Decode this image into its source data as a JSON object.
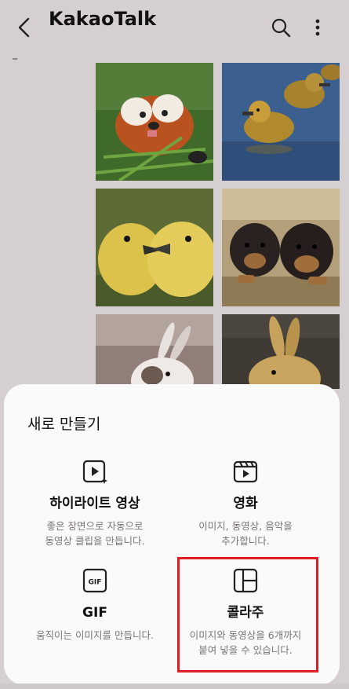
{
  "header": {
    "title": "KakaoTalk"
  },
  "photos": [
    {
      "name": "red-panda-photo"
    },
    {
      "name": "ducklings-photo"
    },
    {
      "name": "goslings-photo"
    },
    {
      "name": "puppies-photo"
    },
    {
      "name": "bunny-photo"
    },
    {
      "name": "golden-bunny-photo"
    }
  ],
  "sheet": {
    "title": "새로 만들기",
    "options": [
      {
        "label": "하이라이트 영상",
        "desc": "좋은 장면으로 자동으로\n동영상 클립을 만듭니다.",
        "icon": "highlight-video-icon"
      },
      {
        "label": "영화",
        "desc": "이미지, 동영상, 음악을\n추가합니다.",
        "icon": "movie-clapper-icon"
      },
      {
        "label": "GIF",
        "desc": "움직이는 이미지를 만듭니다.",
        "icon": "gif-icon",
        "icon_text": "GIF"
      },
      {
        "label": "콜라주",
        "desc": "이미지와 동영상을 6개까지\n붙여 넣을 수 있습니다.",
        "icon": "collage-icon"
      }
    ]
  },
  "colors": {
    "background": "#d6cfd2",
    "sheet": "#fbfafa",
    "highlight": "#e11b22"
  }
}
